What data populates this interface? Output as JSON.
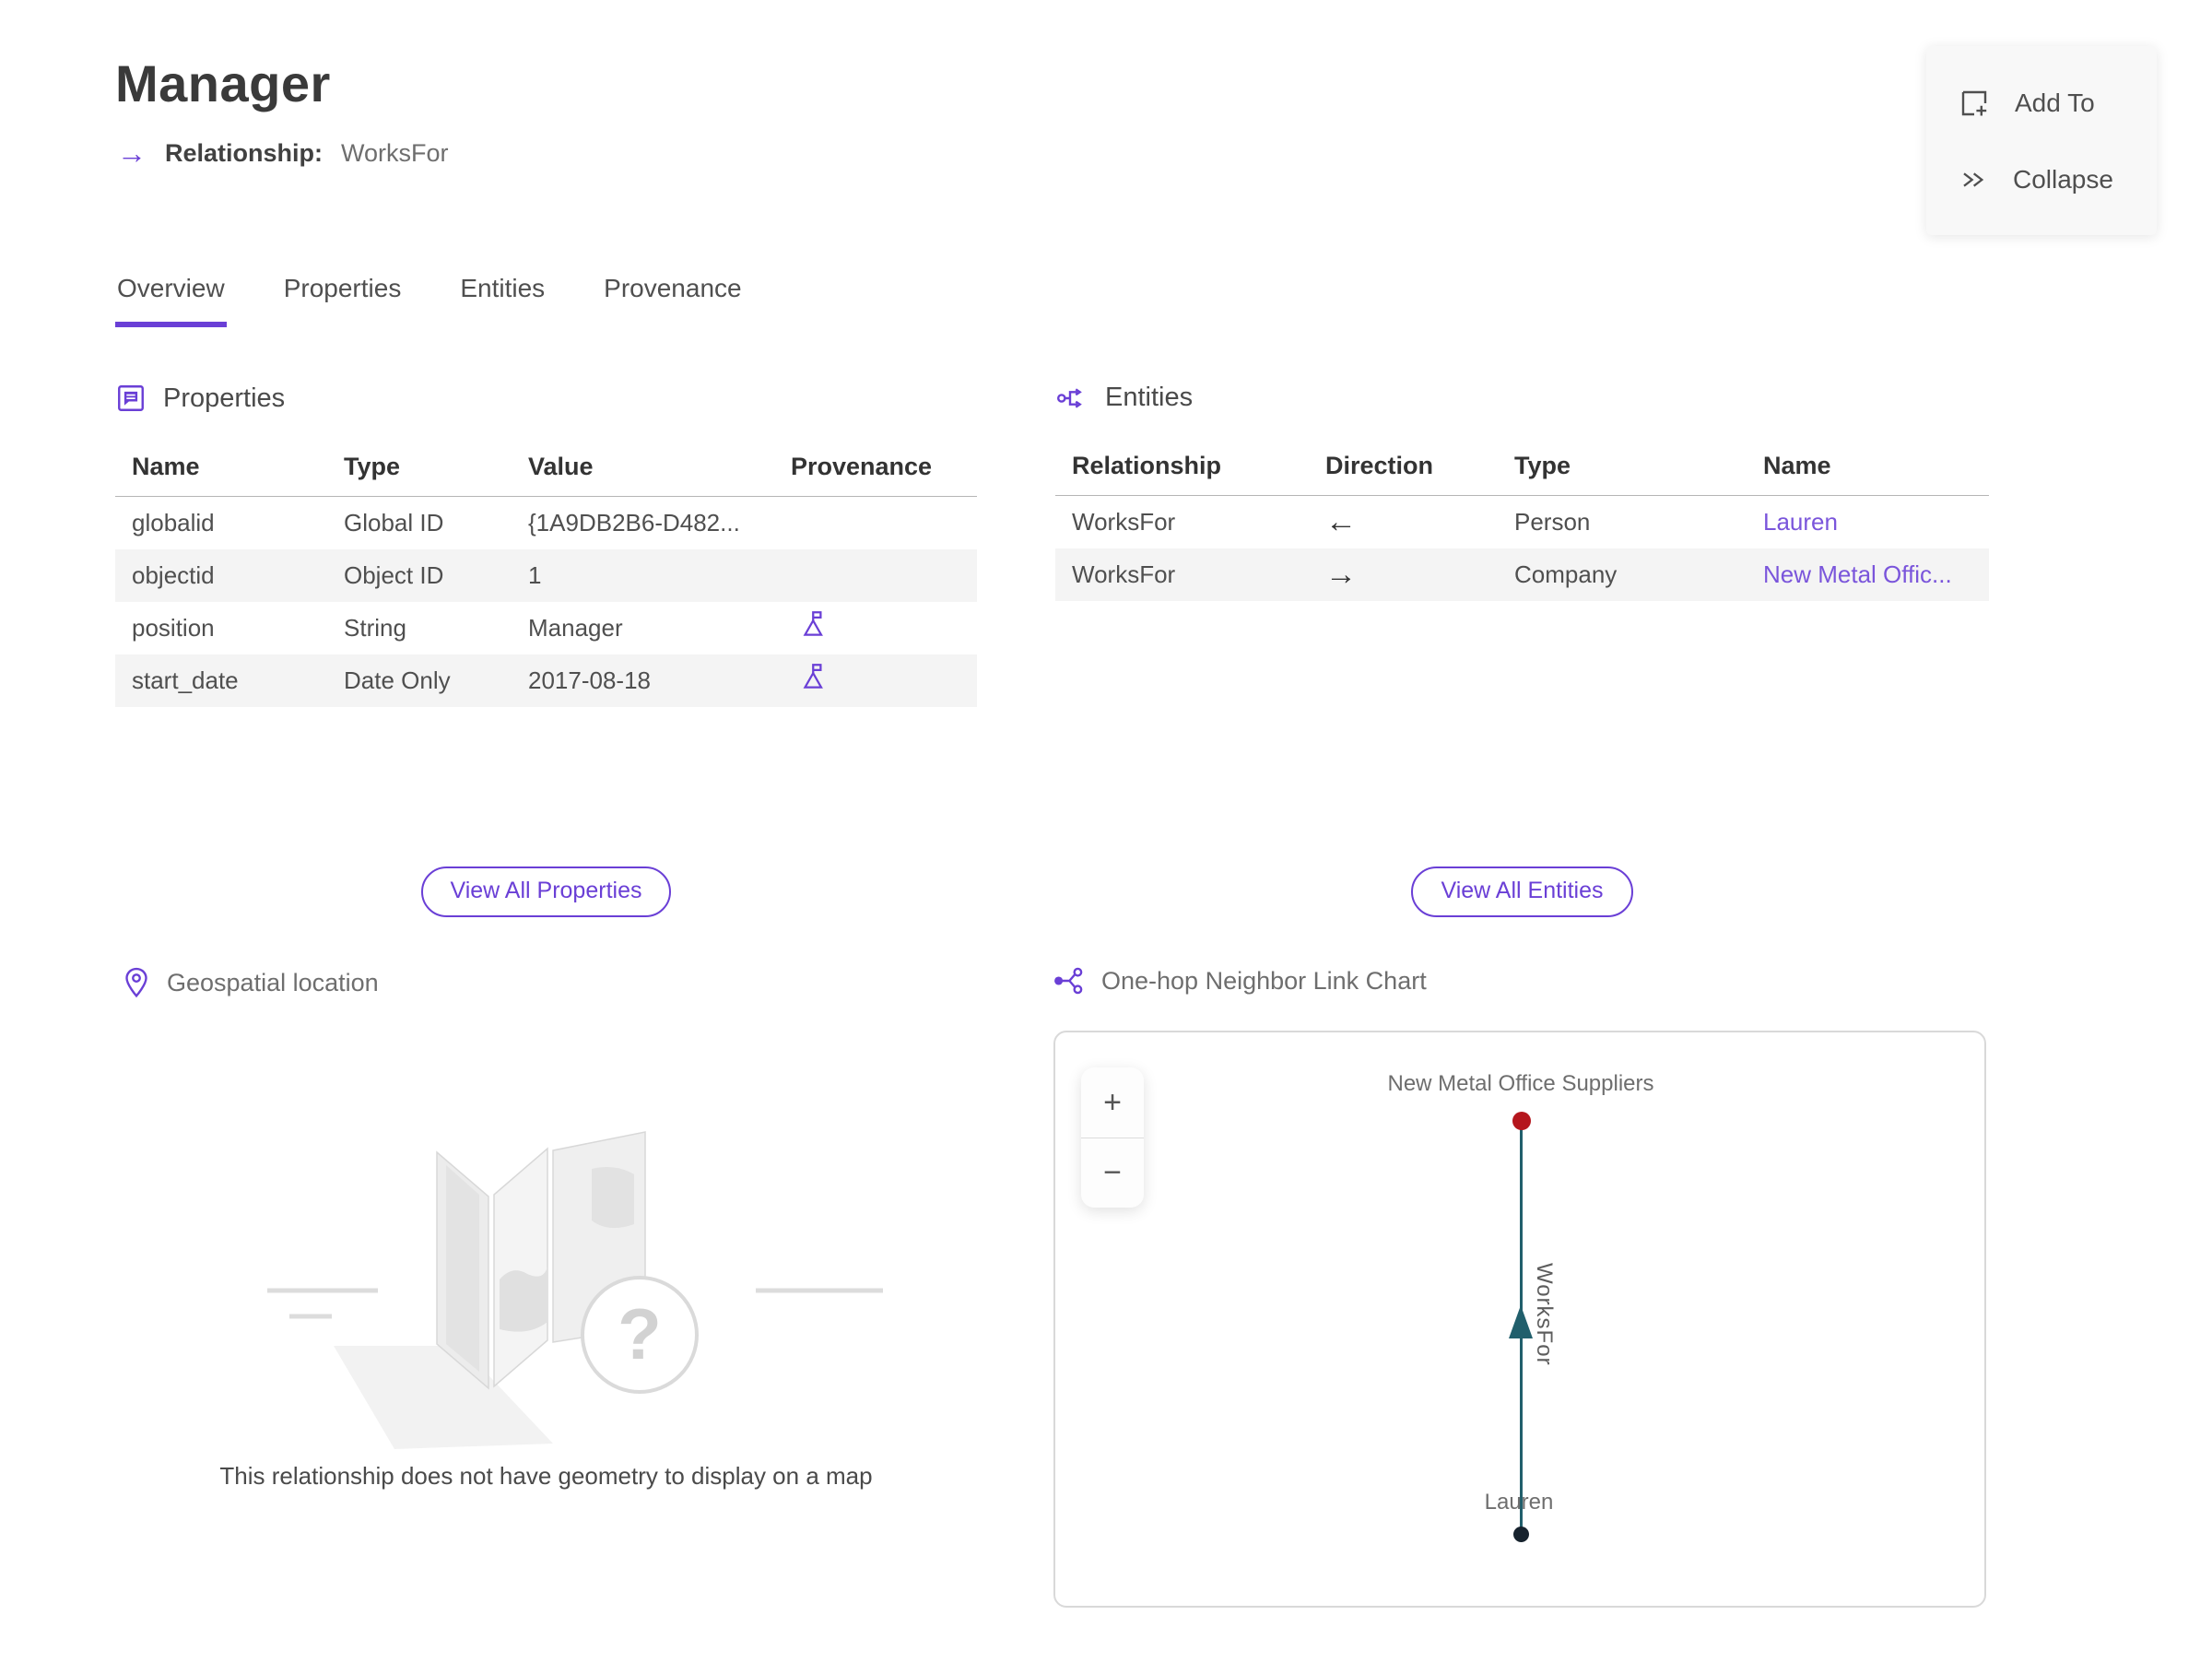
{
  "colors": {
    "accent": "#6a3fd6",
    "link": "#7a55db"
  },
  "header": {
    "title": "Manager",
    "type_arrow": "→",
    "subtitle_label": "Relationship:",
    "subtitle_value": "WorksFor"
  },
  "actions": {
    "add_to": "Add To",
    "collapse": "Collapse"
  },
  "tabs": [
    {
      "label": "Overview"
    },
    {
      "label": "Properties"
    },
    {
      "label": "Entities"
    },
    {
      "label": "Provenance"
    }
  ],
  "properties": {
    "title": "Properties",
    "columns": [
      "Name",
      "Type",
      "Value",
      "Provenance"
    ],
    "rows": [
      {
        "name": "globalid",
        "type": "Global ID",
        "value": "{1A9DB2B6-D482...",
        "has_provenance": false
      },
      {
        "name": "objectid",
        "type": "Object ID",
        "value": "1",
        "has_provenance": false
      },
      {
        "name": "position",
        "type": "String",
        "value": "Manager",
        "has_provenance": true
      },
      {
        "name": "start_date",
        "type": "Date Only",
        "value": "2017-08-18",
        "has_provenance": true
      }
    ],
    "view_all_label": "View All Properties"
  },
  "entities": {
    "title": "Entities",
    "columns": [
      "Relationship",
      "Direction",
      "Type",
      "Name"
    ],
    "rows": [
      {
        "relationship": "WorksFor",
        "direction": "←",
        "type": "Person",
        "name": "Lauren"
      },
      {
        "relationship": "WorksFor",
        "direction": "→",
        "type": "Company",
        "name": "New Metal Offic..."
      }
    ],
    "view_all_label": "View All Entities"
  },
  "geospatial": {
    "title": "Geospatial location",
    "placeholder_glyph": "?",
    "empty_message": "This relationship does not have geometry to display on a map"
  },
  "link_chart": {
    "title": "One-hop Neighbor Link Chart",
    "zoom_in": "+",
    "zoom_out": "−",
    "graph": {
      "nodes": [
        {
          "id": "company",
          "label": "New Metal Office Suppliers",
          "color": "#b5161d"
        },
        {
          "id": "person",
          "label": "Lauren",
          "color": "#17232e"
        }
      ],
      "edge": {
        "label": "WorksFor",
        "from": "Lauren",
        "to": "New Metal Office Suppliers",
        "color": "#215f6c"
      }
    }
  }
}
